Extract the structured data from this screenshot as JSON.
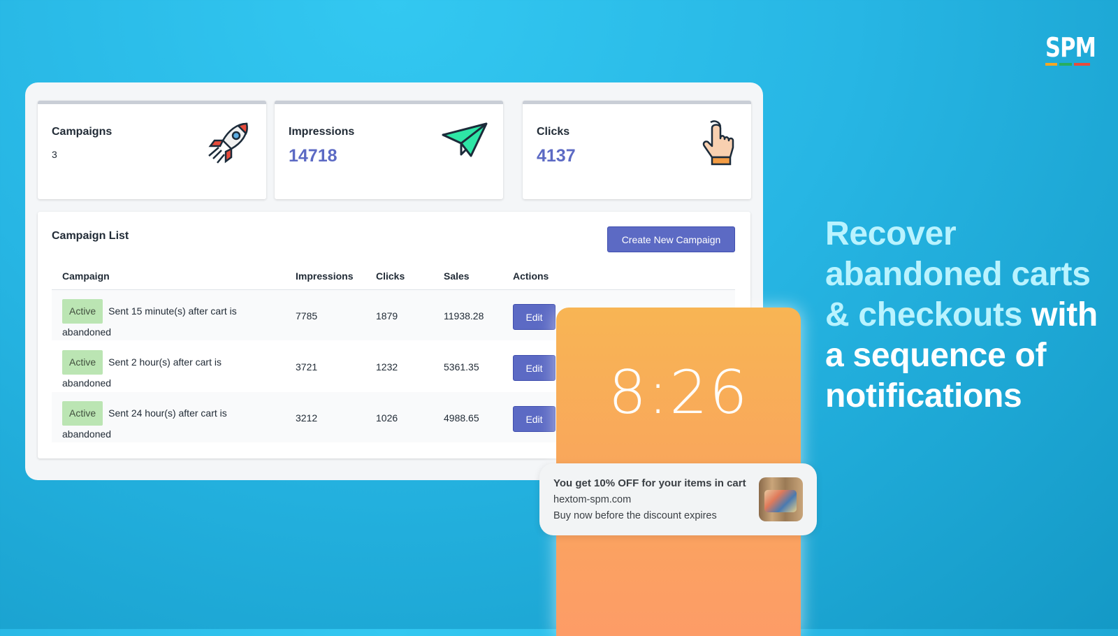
{
  "logo": {
    "text": "SPM",
    "bar_colors": [
      "#f5a623",
      "#27ae60",
      "#e74c3c"
    ]
  },
  "stats": [
    {
      "label": "Campaigns",
      "value": "3",
      "icon": "rocket-icon"
    },
    {
      "label": "Impressions",
      "value": "14718",
      "icon": "paper-plane-icon"
    },
    {
      "label": "Clicks",
      "value": "4137",
      "icon": "pointer-hand-icon"
    }
  ],
  "campaign_list": {
    "title": "Campaign List",
    "create_label": "Create New Campaign",
    "columns": [
      "Campaign",
      "Impressions",
      "Clicks",
      "Sales",
      "Actions"
    ],
    "rows": [
      {
        "status": "Active",
        "description": "Sent 15 minute(s) after cart is abandoned",
        "impressions": "7785",
        "clicks": "1879",
        "sales": "11938.28",
        "action": "Edit"
      },
      {
        "status": "Active",
        "description": "Sent 2 hour(s) after cart is abandoned",
        "impressions": "3721",
        "clicks": "1232",
        "sales": "5361.35",
        "action": "Edit"
      },
      {
        "status": "Active",
        "description": "Sent 24 hour(s) after cart is abandoned",
        "impressions": "3212",
        "clicks": "1026",
        "sales": "4988.65",
        "action": "Edit"
      }
    ]
  },
  "phone": {
    "time": "8:26"
  },
  "notification": {
    "title": "You get 10% OFF for your items in cart",
    "site": "hextom-spm.com",
    "message": "Buy now before the discount expires"
  },
  "headline": {
    "highlight": "Recover abandoned carts & checkouts",
    "rest": " with a sequence of notifications"
  },
  "colors": {
    "accent": "#5c6ac4",
    "badge": "#bbe5b3",
    "highlight": "#b9f3ff"
  }
}
